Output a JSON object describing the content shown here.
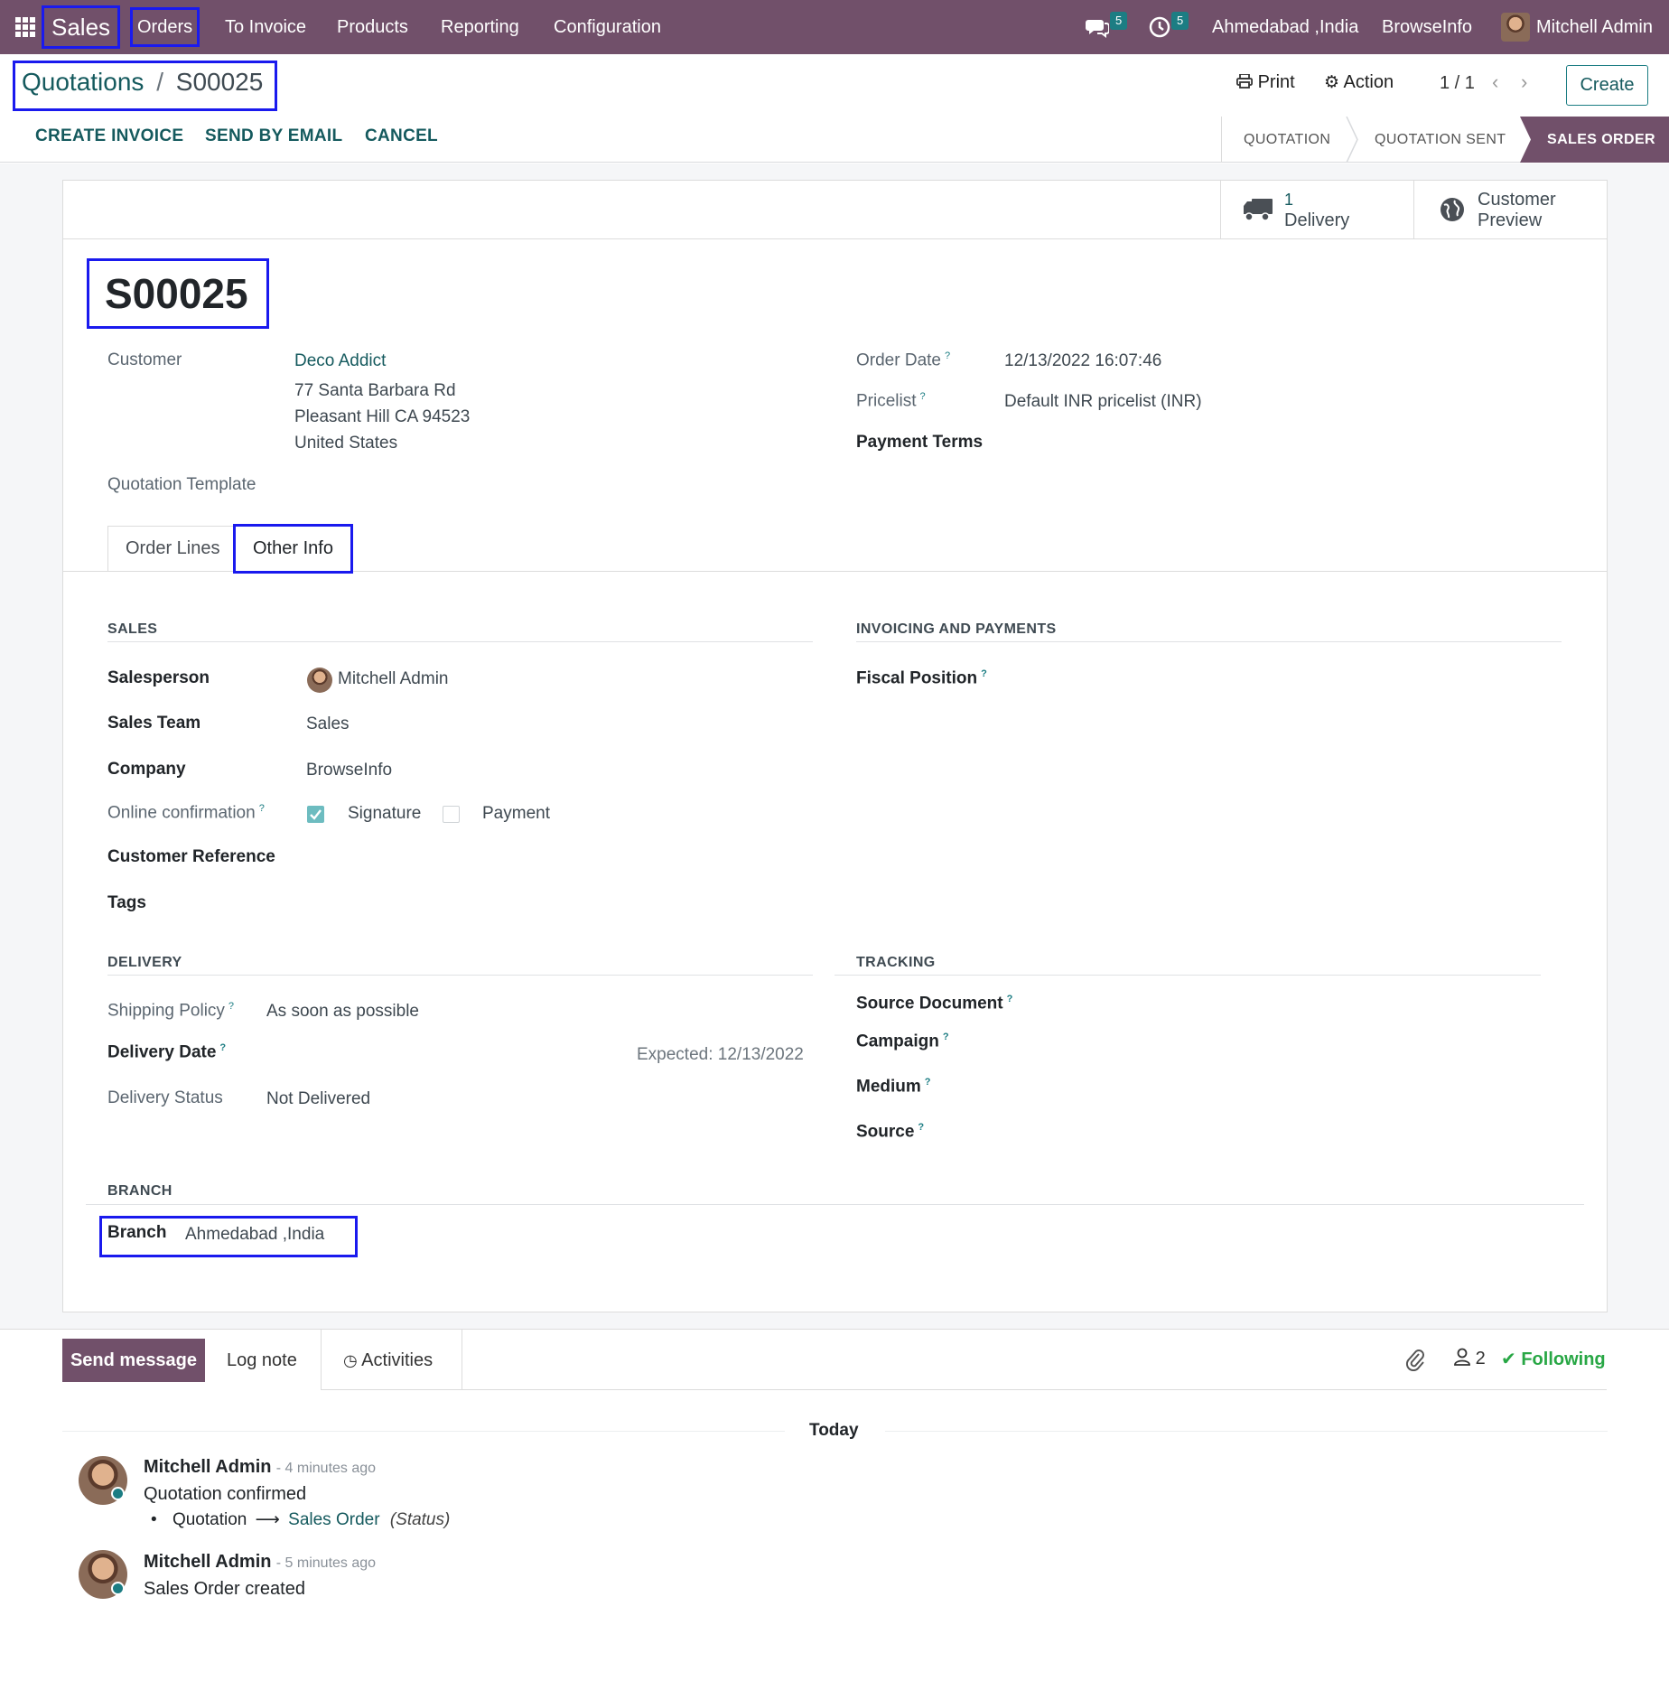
{
  "navbar": {
    "app": "Sales",
    "menus": [
      "Orders",
      "To Invoice",
      "Products",
      "Reporting",
      "Configuration"
    ],
    "messages_count": "5",
    "activities_count": "5",
    "branch": "Ahmedabad ,India",
    "company": "BrowseInfo",
    "user": "Mitchell Admin"
  },
  "breadcrumb": {
    "parent": "Quotations",
    "separator": "/",
    "current": "S00025"
  },
  "control": {
    "print": "Print",
    "action": "Action",
    "pager": "1 / 1",
    "create": "Create"
  },
  "statusbar_buttons": [
    "CREATE INVOICE",
    "SEND BY EMAIL",
    "CANCEL"
  ],
  "stages": [
    "QUOTATION",
    "QUOTATION SENT",
    "SALES ORDER"
  ],
  "active_stage": "SALES ORDER",
  "smart_buttons": {
    "delivery_count": "1",
    "delivery_label": "Delivery",
    "preview_line1": "Customer",
    "preview_line2": "Preview"
  },
  "order": {
    "name": "S00025",
    "customer_label": "Customer",
    "customer_name": "Deco Addict",
    "address": [
      "77 Santa Barbara Rd",
      "Pleasant Hill CA 94523",
      "United States"
    ],
    "template_label": "Quotation Template",
    "order_date_label": "Order Date",
    "order_date": "12/13/2022 16:07:46",
    "pricelist_label": "Pricelist",
    "pricelist": "Default INR pricelist (INR)",
    "payment_terms_label": "Payment Terms"
  },
  "tabs": [
    "Order Lines",
    "Other Info"
  ],
  "active_tab": "Other Info",
  "sales": {
    "title": "SALES",
    "salesperson_label": "Salesperson",
    "salesperson": "Mitchell Admin",
    "team_label": "Sales Team",
    "team": "Sales",
    "company_label": "Company",
    "company": "BrowseInfo",
    "online_label": "Online confirmation",
    "signature_label": "Signature",
    "signature_checked": true,
    "payment_label": "Payment",
    "payment_checked": false,
    "customer_ref_label": "Customer Reference",
    "tags_label": "Tags"
  },
  "invoicing": {
    "title": "INVOICING AND PAYMENTS",
    "fiscal_label": "Fiscal Position"
  },
  "delivery": {
    "title": "DELIVERY",
    "shipping_label": "Shipping Policy",
    "shipping": "As soon as possible",
    "date_label": "Delivery Date",
    "expected": "Expected: 12/13/2022",
    "status_label": "Delivery Status",
    "status": "Not Delivered"
  },
  "tracking": {
    "title": "TRACKING",
    "source_doc_label": "Source Document",
    "campaign_label": "Campaign",
    "medium_label": "Medium",
    "source_label": "Source"
  },
  "branch_section": {
    "title": "BRANCH",
    "label": "Branch",
    "value": "Ahmedabad ,India"
  },
  "chatter": {
    "send": "Send message",
    "log": "Log note",
    "activities": "Activities",
    "followers": "2",
    "following": "Following",
    "today": "Today",
    "messages": [
      {
        "author": "Mitchell Admin",
        "time": "- 4 minutes ago",
        "body": "Quotation confirmed",
        "change_from": "Quotation",
        "change_to": "Sales Order",
        "field": "(Status)"
      },
      {
        "author": "Mitchell Admin",
        "time": "- 5 minutes ago",
        "body": "Sales Order created"
      }
    ]
  },
  "colors": {
    "navbar": "#71506a",
    "accent": "#155a5e",
    "teal": "#1c7d83",
    "highlight": "#1a1aee"
  }
}
